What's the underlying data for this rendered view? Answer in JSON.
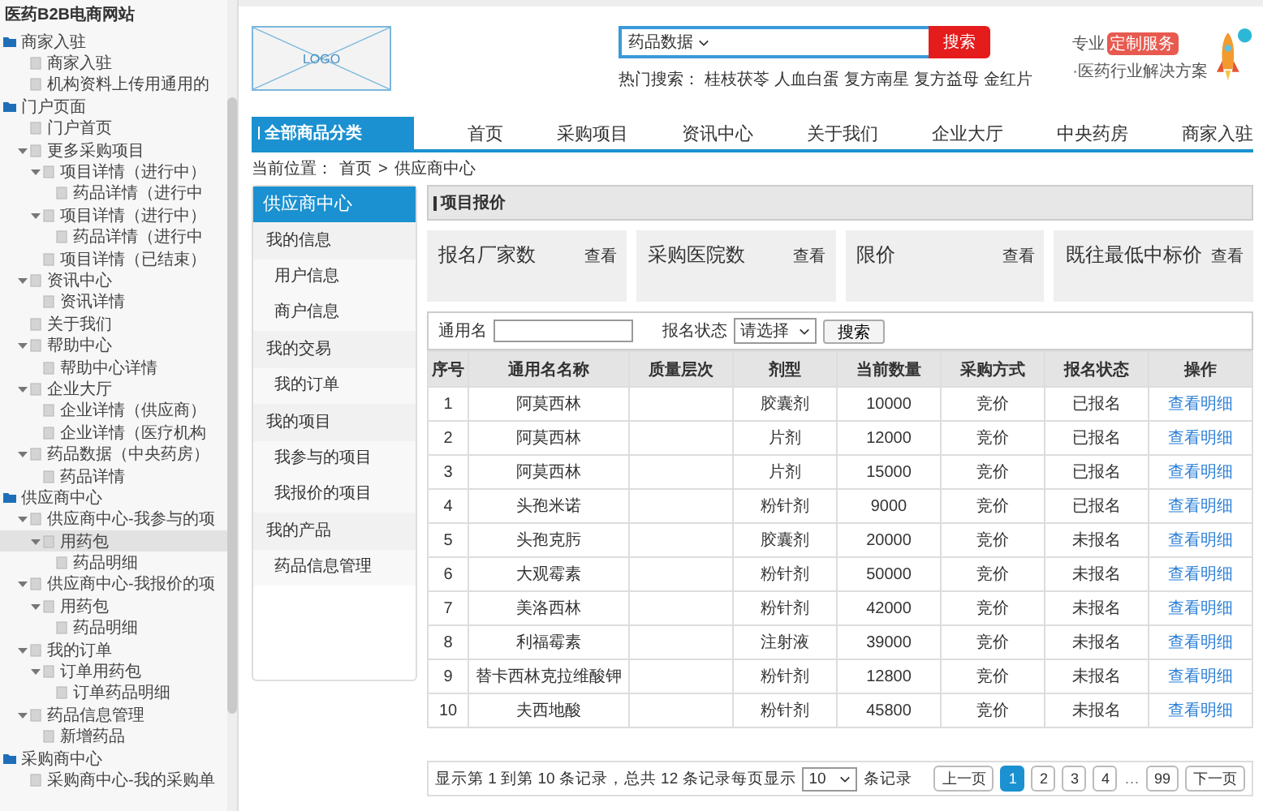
{
  "sidebar_tree": {
    "title": "医药B2B电商网站",
    "items": [
      {
        "label": "商家入驻",
        "kind": "folder",
        "expanded": true,
        "selected": false,
        "children": [
          {
            "label": "商家入驻",
            "kind": "page",
            "selected": false
          },
          {
            "label": "机构资料上传用通用的",
            "kind": "page",
            "selected": false
          }
        ]
      },
      {
        "label": "门户页面",
        "kind": "folder",
        "expanded": true,
        "selected": false,
        "children": [
          {
            "label": "门户首页",
            "kind": "page",
            "selected": false
          },
          {
            "label": "更多采购项目",
            "kind": "page",
            "expanded": true,
            "selected": false,
            "children": [
              {
                "label": "项目详情（进行中）",
                "kind": "page",
                "expanded": true,
                "selected": false,
                "children": [
                  {
                    "label": "药品详情（进行中",
                    "kind": "page",
                    "selected": false
                  }
                ]
              },
              {
                "label": "项目详情（进行中）",
                "kind": "page",
                "expanded": true,
                "selected": false,
                "children": [
                  {
                    "label": "药品详情（进行中",
                    "kind": "page",
                    "selected": false
                  }
                ]
              },
              {
                "label": "项目详情（已结束）",
                "kind": "page",
                "selected": false
              }
            ]
          },
          {
            "label": "资讯中心",
            "kind": "page",
            "expanded": true,
            "selected": false,
            "children": [
              {
                "label": "资讯详情",
                "kind": "page",
                "selected": false
              }
            ]
          },
          {
            "label": "关于我们",
            "kind": "page",
            "selected": false
          },
          {
            "label": "帮助中心",
            "kind": "page",
            "expanded": true,
            "selected": false,
            "children": [
              {
                "label": "帮助中心详情",
                "kind": "page",
                "selected": false
              }
            ]
          },
          {
            "label": "企业大厅",
            "kind": "page",
            "expanded": true,
            "selected": false,
            "children": [
              {
                "label": "企业详情（供应商）",
                "kind": "page",
                "selected": false
              },
              {
                "label": "企业详情（医疗机构",
                "kind": "page",
                "selected": false
              }
            ]
          },
          {
            "label": "药品数据（中央药房）",
            "kind": "page",
            "expanded": true,
            "selected": false,
            "children": [
              {
                "label": "药品详情",
                "kind": "page",
                "selected": false
              }
            ]
          }
        ]
      },
      {
        "label": "供应商中心",
        "kind": "folder",
        "expanded": true,
        "selected": false,
        "children": [
          {
            "label": "供应商中心-我参与的项",
            "kind": "page",
            "expanded": true,
            "selected": false,
            "children": [
              {
                "label": "用药包",
                "kind": "page",
                "expanded": true,
                "selected": true,
                "children": [
                  {
                    "label": "药品明细",
                    "kind": "page",
                    "selected": false
                  }
                ]
              }
            ]
          },
          {
            "label": "供应商中心-我报价的项",
            "kind": "page",
            "expanded": true,
            "selected": false,
            "children": [
              {
                "label": "用药包",
                "kind": "page",
                "expanded": true,
                "selected": false,
                "children": [
                  {
                    "label": "药品明细",
                    "kind": "page",
                    "selected": false
                  }
                ]
              }
            ]
          },
          {
            "label": "我的订单",
            "kind": "page",
            "expanded": true,
            "selected": false,
            "children": [
              {
                "label": "订单用药包",
                "kind": "page",
                "expanded": true,
                "selected": false,
                "children": [
                  {
                    "label": "订单药品明细",
                    "kind": "page",
                    "selected": false
                  }
                ]
              }
            ]
          },
          {
            "label": "药品信息管理",
            "kind": "page",
            "expanded": true,
            "selected": false,
            "children": [
              {
                "label": "新增药品",
                "kind": "page",
                "selected": false
              }
            ]
          }
        ]
      },
      {
        "label": "采购商中心",
        "kind": "folder",
        "expanded": true,
        "selected": false,
        "children": [
          {
            "label": "采购商中心-我的采购单",
            "kind": "page",
            "selected": false
          }
        ]
      }
    ]
  },
  "header": {
    "logo": "LOGO",
    "search": {
      "category": "药品数据",
      "button": "搜索"
    },
    "hot_search": {
      "label": "热门搜索：",
      "terms": [
        "桂枝茯苓",
        "人血白蛋",
        "复方南星",
        "复方益母",
        "金红片"
      ]
    },
    "promo": {
      "prefix": "专业",
      "highlight": "定制服务",
      "tagline": "·医药行业解决方案"
    }
  },
  "nav": {
    "category": "全部商品分类",
    "items": [
      "首页",
      "采购项目",
      "资讯中心",
      "关于我们",
      "企业大厅",
      "中央药房",
      "商家入驻"
    ]
  },
  "breadcrumb": {
    "label": "当前位置：",
    "items": [
      "首页",
      "供应商中心"
    ],
    "separator": ">"
  },
  "side_menu": {
    "title": "供应商中心",
    "items": [
      {
        "label": "我的信息",
        "kind": "group"
      },
      {
        "label": "用户信息",
        "kind": "item"
      },
      {
        "label": "商户信息",
        "kind": "item"
      },
      {
        "label": "我的交易",
        "kind": "group"
      },
      {
        "label": "我的订单",
        "kind": "item"
      },
      {
        "label": "我的项目",
        "kind": "group"
      },
      {
        "label": "我参与的项目",
        "kind": "item"
      },
      {
        "label": "我报价的项目",
        "kind": "item"
      },
      {
        "label": "我的产品",
        "kind": "group"
      },
      {
        "label": "药品信息管理",
        "kind": "item"
      }
    ]
  },
  "section_title": "项目报价",
  "stats": [
    {
      "label": "报名厂家数",
      "link": "查看"
    },
    {
      "label": "采购医院数",
      "link": "查看"
    },
    {
      "label": "限价",
      "link": "查看"
    },
    {
      "label": "既往最低中标价",
      "link": "查看"
    }
  ],
  "filter": {
    "name_label": "通用名",
    "status_label": "报名状态",
    "status_value": "请选择",
    "button": "搜索"
  },
  "table": {
    "columns": [
      "序号",
      "通用名名称",
      "质量层次",
      "剂型",
      "当前数量",
      "采购方式",
      "报名状态",
      "操作"
    ],
    "rows": [
      {
        "no": "1",
        "name": "阿莫西林",
        "form": "胶囊剂",
        "quantity": "10000",
        "method": "竞价",
        "status": "已报名",
        "action": "查看明细"
      },
      {
        "no": "2",
        "name": "阿莫西林",
        "form": "片剂",
        "quantity": "12000",
        "method": "竞价",
        "status": "已报名",
        "action": "查看明细"
      },
      {
        "no": "3",
        "name": "阿莫西林",
        "form": "片剂",
        "quantity": "15000",
        "method": "竞价",
        "status": "已报名",
        "action": "查看明细"
      },
      {
        "no": "4",
        "name": "头孢米诺",
        "form": "粉针剂",
        "quantity": "9000",
        "method": "竞价",
        "status": "已报名",
        "action": "查看明细"
      },
      {
        "no": "5",
        "name": "头孢克肟",
        "form": "胶囊剂",
        "quantity": "20000",
        "method": "竞价",
        "status": "未报名",
        "action": "查看明细"
      },
      {
        "no": "6",
        "name": "大观霉素",
        "form": "粉针剂",
        "quantity": "50000",
        "method": "竞价",
        "status": "未报名",
        "action": "查看明细"
      },
      {
        "no": "7",
        "name": "美洛西林",
        "form": "粉针剂",
        "quantity": "42000",
        "method": "竞价",
        "status": "未报名",
        "action": "查看明细"
      },
      {
        "no": "8",
        "name": "利福霉素",
        "form": "注射液",
        "quantity": "39000",
        "method": "竞价",
        "status": "未报名",
        "action": "查看明细"
      },
      {
        "no": "9",
        "name": "替卡西林克拉维酸钾",
        "form": "粉针剂",
        "quantity": "12800",
        "method": "竞价",
        "status": "未报名",
        "action": "查看明细"
      },
      {
        "no": "10",
        "name": "夫西地酸",
        "form": "粉针剂",
        "quantity": "45800",
        "method": "竞价",
        "status": "未报名",
        "action": "查看明细"
      }
    ]
  },
  "pagination": {
    "summary": "显示第 1 到第 10 条记录，总共 12 条记录每页显示",
    "page_size": "10",
    "suffix": "条记录",
    "pages": [
      {
        "label": "上一页",
        "kind": "nav"
      },
      {
        "label": "1",
        "kind": "page",
        "selected": true
      },
      {
        "label": "2",
        "kind": "page",
        "selected": false
      },
      {
        "label": "3",
        "kind": "page",
        "selected": false
      },
      {
        "label": "4",
        "kind": "page",
        "selected": false
      },
      {
        "label": "…",
        "kind": "gap"
      },
      {
        "label": "99",
        "kind": "page",
        "selected": false
      },
      {
        "label": "下一页",
        "kind": "nav"
      }
    ]
  }
}
